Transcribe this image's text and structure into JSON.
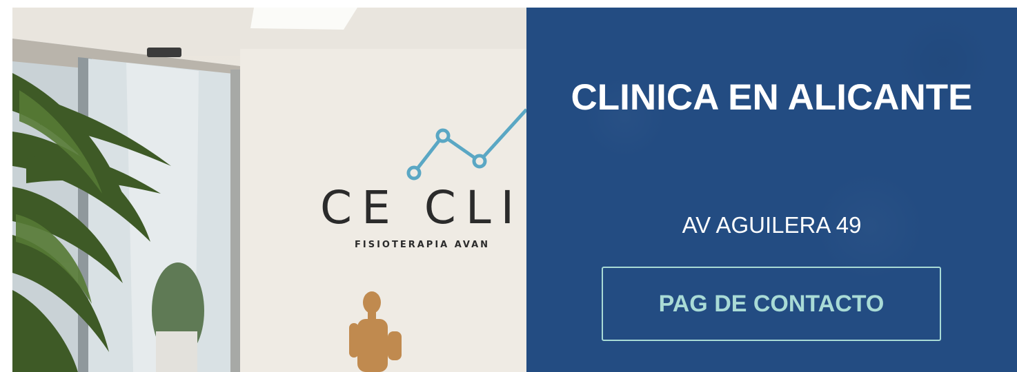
{
  "photo": {
    "sign_name": "CE CLI",
    "sign_subtitle": "FISIOTERAPIA AVAN",
    "logo_icon": "line-graph-logo-icon"
  },
  "info": {
    "title": "CLINICA EN ALICANTE",
    "address": "AV AGUILERA 49",
    "contact_button_label": "PAG DE CONTACTO"
  },
  "colors": {
    "panel_background": "#234c82",
    "button_accent": "#a9dbd6",
    "title_text": "#ffffff"
  }
}
